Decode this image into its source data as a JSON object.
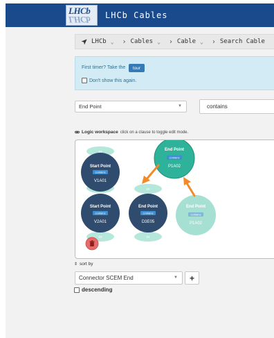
{
  "header": {
    "app_title": "LHCb Cables",
    "logo_text_top": "LHCb",
    "logo_text_reflection": "LHCb"
  },
  "breadcrumb": {
    "items": [
      {
        "label": "LHCb",
        "icon": "navigation-arrow-icon"
      },
      {
        "label": "Cables"
      },
      {
        "label": "Cable"
      },
      {
        "label": "Search Cable"
      }
    ]
  },
  "tour": {
    "text": "First timer? Take the",
    "button_label": "tour",
    "dont_show_label": "Don't show this again."
  },
  "filter": {
    "field_value": "End Point",
    "operator_value": "contains"
  },
  "logic_workspace": {
    "title": "Logic workspace",
    "hint": "click on a clause to toggle edit mode.",
    "or_label": "or",
    "nodes": [
      {
        "title": "Start Point",
        "badge": "contains",
        "value": "V1A01"
      },
      {
        "title": "Start Point",
        "badge": "contains",
        "value": "V2A01"
      },
      {
        "title": "End Point",
        "badge": "contains",
        "value": "D3E05"
      },
      {
        "title": "End Point",
        "badge": "contains",
        "value": "P1A02"
      },
      {
        "title": "End Point",
        "badge": "contains",
        "value": "P1A02"
      }
    ]
  },
  "sort": {
    "label": "sort by",
    "select_value": "Connector SCEM End",
    "add_label": "+",
    "descending_label": "descending"
  },
  "colors": {
    "header_bg": "#1b4a8c",
    "node_dark": "#2f4b6e",
    "node_teal": "#2eb39a",
    "node_light": "#a6e0d3",
    "or_pill": "#b5e7db",
    "arrow": "#f28b27",
    "delete_button": "#e86b6b",
    "badge": "#3d8fd1"
  }
}
